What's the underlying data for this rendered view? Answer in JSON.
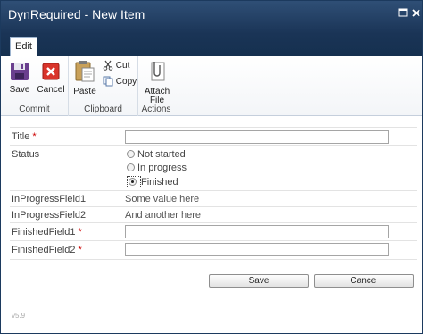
{
  "window": {
    "title": "DynRequired - New Item"
  },
  "ribbon": {
    "tab": "Edit",
    "groups": {
      "commit": {
        "label": "Commit",
        "save": "Save",
        "cancel": "Cancel"
      },
      "clipboard": {
        "label": "Clipboard",
        "paste": "Paste",
        "cut": "Cut",
        "copy": "Copy"
      },
      "actions": {
        "label": "Actions",
        "attach_line1": "Attach",
        "attach_line2": "File"
      }
    }
  },
  "form": {
    "title": {
      "label": "Title",
      "required": "*",
      "value": ""
    },
    "status": {
      "label": "Status",
      "options": [
        "Not started",
        "In progress",
        "Finished"
      ],
      "selected": "Finished"
    },
    "in_progress_1": {
      "label": "InProgressField1",
      "value": "Some value here"
    },
    "in_progress_2": {
      "label": "InProgressField2",
      "value": "And another here"
    },
    "finished_1": {
      "label": "FinishedField1",
      "required": "*",
      "value": ""
    },
    "finished_2": {
      "label": "FinishedField2",
      "required": "*",
      "value": ""
    }
  },
  "buttons": {
    "save": "Save",
    "cancel": "Cancel"
  },
  "footer": {
    "version": "v5.9"
  },
  "icons": [
    "maximize-icon",
    "close-icon",
    "save-icon",
    "cancel-icon",
    "paste-icon",
    "cut-icon",
    "copy-icon",
    "attach-file-icon"
  ]
}
